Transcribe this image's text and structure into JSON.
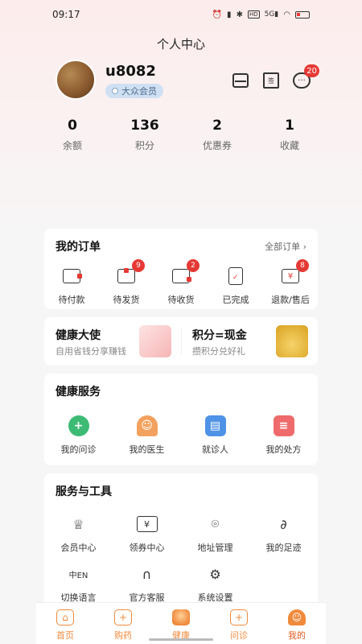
{
  "status": {
    "time": "09:17",
    "icons": [
      "alarm-icon",
      "vibrate-icon",
      "bluetooth-icon",
      "hd-icon",
      "signal-5g-icon",
      "wifi-icon",
      "battery-low-icon"
    ]
  },
  "page": {
    "title": "个人中心"
  },
  "profile": {
    "username": "u8082",
    "member_level": "大众会员",
    "message_badge": "20",
    "calendar_label": "签"
  },
  "stats": [
    {
      "value": "0",
      "label": "余额"
    },
    {
      "value": "136",
      "label": "积分"
    },
    {
      "value": "2",
      "label": "优惠券"
    },
    {
      "value": "1",
      "label": "收藏"
    }
  ],
  "orders": {
    "title": "我的订单",
    "all_label": "全部订单",
    "items": [
      {
        "label": "待付款",
        "badge": ""
      },
      {
        "label": "待发货",
        "badge": "9"
      },
      {
        "label": "待收货",
        "badge": "2"
      },
      {
        "label": "已完成",
        "badge": ""
      },
      {
        "label": "退款/售后",
        "badge": "8"
      }
    ]
  },
  "promos": [
    {
      "title": "健康大使",
      "subtitle": "自用省钱分享赚钱"
    },
    {
      "title": "积分=现金",
      "subtitle": "攒积分兑好礼"
    }
  ],
  "health_services": {
    "title": "健康服务",
    "items": [
      {
        "label": "我的问诊",
        "icon": "consult-icon"
      },
      {
        "label": "我的医生",
        "icon": "doctor-icon"
      },
      {
        "label": "就诊人",
        "icon": "patient-card-icon"
      },
      {
        "label": "我的处方",
        "icon": "prescription-icon"
      }
    ]
  },
  "tools": {
    "title": "服务与工具",
    "items": [
      {
        "label": "会员中心",
        "icon": "crown-icon"
      },
      {
        "label": "领券中心",
        "icon": "coupon-icon"
      },
      {
        "label": "地址管理",
        "icon": "location-icon"
      },
      {
        "label": "我的足迹",
        "icon": "footprint-icon"
      },
      {
        "label": "切换语言",
        "icon": "language-icon"
      },
      {
        "label": "官方客服",
        "icon": "headset-icon"
      },
      {
        "label": "系统设置",
        "icon": "settings-icon"
      }
    ]
  },
  "tabbar": [
    {
      "label": "首页"
    },
    {
      "label": "购药"
    },
    {
      "label": "健康"
    },
    {
      "label": "问诊"
    },
    {
      "label": "我的"
    }
  ],
  "colors": {
    "accent": "#f08a3c",
    "badge": "#e53935",
    "background": "#f6f6f6"
  }
}
